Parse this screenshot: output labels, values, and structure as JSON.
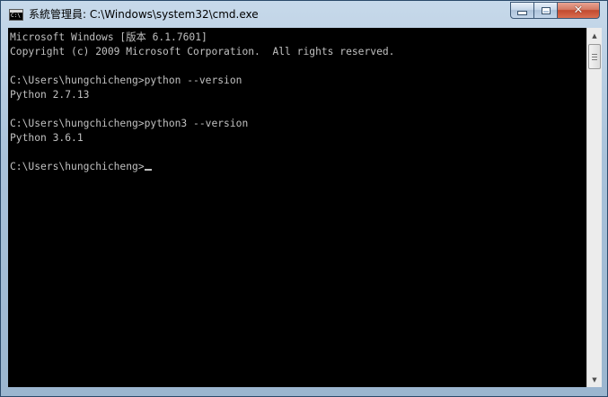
{
  "window": {
    "title": "系統管理員: C:\\Windows\\system32\\cmd.exe",
    "icon": "cmd-console-icon",
    "buttons": {
      "minimize_icon": "minimize-icon",
      "maximize_icon": "maximize-icon",
      "close_icon": "close-icon",
      "close_glyph": "✕"
    }
  },
  "console": {
    "background": "#000000",
    "foreground": "#c0c0c0",
    "lines": [
      "Microsoft Windows [版本 6.1.7601]",
      "Copyright (c) 2009 Microsoft Corporation.  All rights reserved.",
      "",
      "C:\\Users\\hungchicheng>python --version",
      "Python 2.7.13",
      "",
      "C:\\Users\\hungchicheng>python3 --version",
      "Python 3.6.1",
      "",
      "C:\\Users\\hungchicheng>"
    ]
  },
  "scrollbar": {
    "up_glyph": "▲",
    "down_glyph": "▼"
  }
}
